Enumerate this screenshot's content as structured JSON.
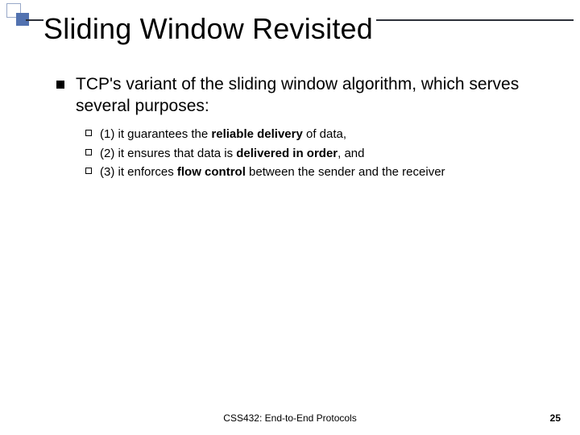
{
  "title": "Sliding Window Revisited",
  "lead": "TCP's variant of the sliding window algorithm, which serves several purposes:",
  "items": {
    "i1": {
      "pre": "(1) it guarantees the ",
      "bold": "reliable delivery",
      "post": " of data,"
    },
    "i2": {
      "pre": "(2) it ensures that data is ",
      "bold": "delivered in order",
      "post": ", and"
    },
    "i3": {
      "pre": "(3) it enforces ",
      "bold": "flow control",
      "post": " between the sender and the receiver"
    }
  },
  "footer": "CSS432: End-to-End Protocols",
  "pagenum": "25"
}
